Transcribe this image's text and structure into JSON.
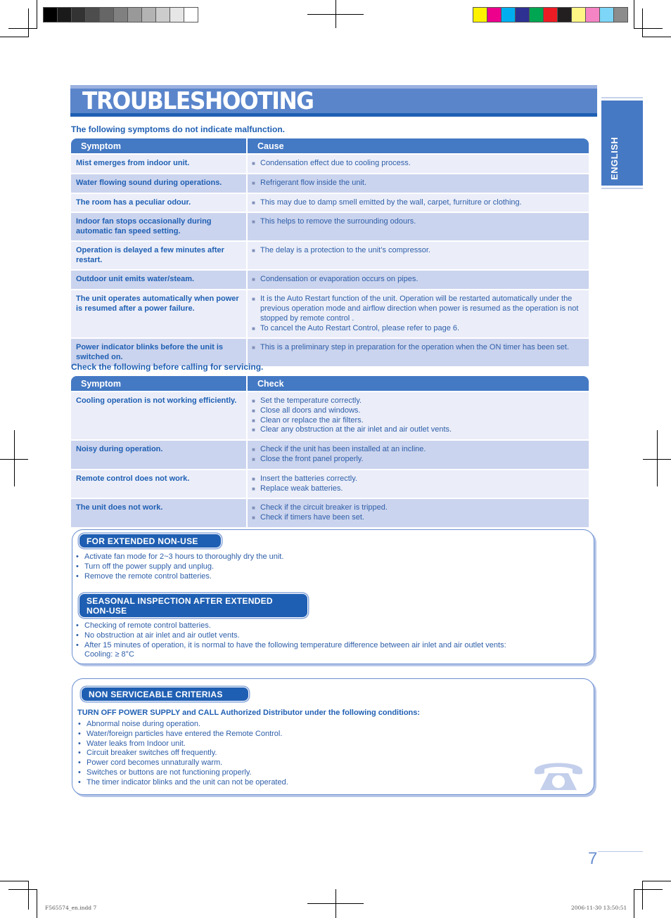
{
  "print_marks": {
    "gray_swatches": [
      "#000000",
      "#1a1a1a",
      "#333333",
      "#4d4d4d",
      "#666666",
      "#808080",
      "#999999",
      "#b3b3b3",
      "#cccccc",
      "#e6e6e6",
      "#ffffff"
    ],
    "color_swatches": [
      "#fff200",
      "#ec008c",
      "#00aeef",
      "#2e3192",
      "#00a651",
      "#ed1c24",
      "#231f20",
      "#fff685",
      "#f484c4",
      "#7dd6f7",
      "#8c8c8c"
    ],
    "slug_left": "F565574_en.indd   7",
    "slug_right": "2006-11-30   13:50:51"
  },
  "page": {
    "title": "TROUBLESHOOTING",
    "language_tab": "ENGLISH",
    "page_number": "7",
    "colors": {
      "accent": "#4479c4",
      "dark_blue": "#1f5fb3",
      "row_light": "#ebeef9",
      "row_dark": "#cbd4ee"
    }
  },
  "malfunction": {
    "heading": "The following symptoms do not indicate malfunction.",
    "col_symptom": "Symptom",
    "col_cause": "Cause",
    "rows": [
      {
        "symptom": "Mist emerges from indoor unit.",
        "causes": [
          "Condensation effect due to cooling process."
        ]
      },
      {
        "symptom": "Water flowing sound during operations.",
        "causes": [
          "Refrigerant flow inside the unit."
        ]
      },
      {
        "symptom": "The room has a peculiar odour.",
        "causes": [
          "This may due to damp smell emitted by the wall, carpet, furniture or clothing."
        ]
      },
      {
        "symptom": "Indoor fan stops occasionally during automatic fan speed setting.",
        "causes": [
          "This helps to remove the surrounding odours."
        ]
      },
      {
        "symptom": "Operation is delayed a few minutes after restart.",
        "causes": [
          "The delay is a protection to the unit’s compressor."
        ]
      },
      {
        "symptom": "Outdoor unit emits water/steam.",
        "causes": [
          "Condensation or evaporation occurs on pipes."
        ]
      },
      {
        "symptom": "The unit operates automatically when power is resumed after a power failure.",
        "causes": [
          "It is the Auto Restart function of the unit. Operation will be restarted automatically under the previous operation mode and airflow direction when power is resumed as the operation is not stopped by remote control .",
          "To cancel the Auto Restart Control, please refer to page 6."
        ]
      },
      {
        "symptom": "Power indicator blinks before the unit is switched on.",
        "causes": [
          "This is a preliminary step in preparation for the operation when the ON timer has been set."
        ]
      }
    ]
  },
  "servicing": {
    "heading": "Check the following before calling for servicing.",
    "col_symptom": "Symptom",
    "col_check": "Check",
    "rows": [
      {
        "symptom": "Cooling operation is not working efficiently.",
        "checks": [
          "Set the temperature correctly.",
          "Close all doors and windows.",
          "Clean or replace the air filters.",
          "Clear any obstruction at the air inlet and air outlet vents."
        ]
      },
      {
        "symptom": "Noisy during operation.",
        "checks": [
          "Check if the unit has been installed at an incline.",
          "Close the front panel properly."
        ]
      },
      {
        "symptom": "Remote control does not work.",
        "checks": [
          "Insert the batteries correctly.",
          "Replace weak batteries."
        ]
      },
      {
        "symptom": "The unit does not work.",
        "checks": [
          "Check if the circuit breaker is tripped.",
          "Check if timers have been set."
        ]
      }
    ]
  },
  "extended_non_use": {
    "title": "FOR EXTENDED NON-USE",
    "items": [
      "Activate fan mode for 2~3 hours to thoroughly dry the unit.",
      "Turn off the power supply and unplug.",
      "Remove the remote control batteries."
    ]
  },
  "seasonal_inspection": {
    "title_line1": "SEASONAL INSPECTION AFTER EXTENDED",
    "title_line2": "NON-USE",
    "items": [
      "Checking of remote control batteries.",
      "No obstruction at air inlet and air outlet vents.",
      "After 15 minutes of operation, it is normal to have the following temperature difference between air inlet and air outlet vents:"
    ],
    "extra_line": "Cooling: ≥ 8°C"
  },
  "non_serviceable": {
    "title": "NON SERVICEABLE CRITERIAS",
    "intro": "TURN OFF POWER SUPPLY and CALL Authorized Distributor under the following conditions:",
    "items": [
      "Abnormal noise during operation.",
      "Water/foreign particles have entered the Remote Control.",
      "Water leaks from Indoor unit.",
      "Circuit breaker switches off frequently.",
      "Power cord becomes unnaturally warm.",
      "Switches or buttons are not functioning properly.",
      "The timer indicator blinks and the unit can not be operated."
    ],
    "icon": "telephone-icon"
  }
}
